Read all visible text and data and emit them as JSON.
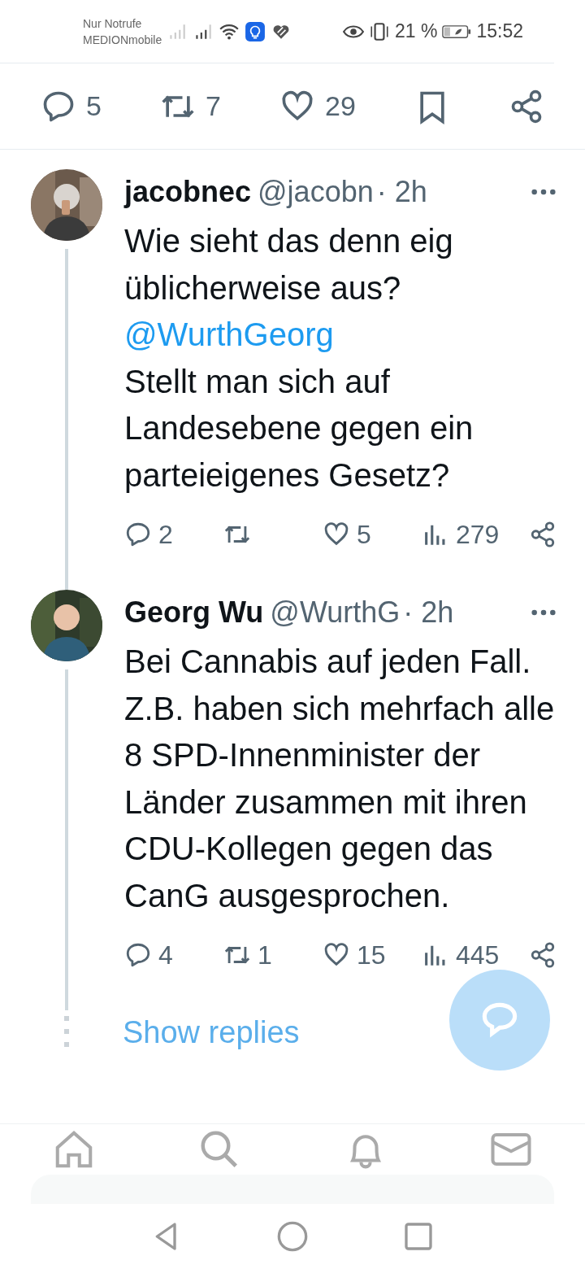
{
  "status_bar": {
    "carrier_lines": [
      "Nur Notrufe",
      "MEDIONmobile"
    ],
    "battery": "21 %",
    "time": "15:52"
  },
  "post_actions": [
    {
      "kind": "reply",
      "count": "5"
    },
    {
      "kind": "retweet",
      "count": "7"
    },
    {
      "kind": "like",
      "count": "29"
    },
    {
      "kind": "bookmark"
    },
    {
      "kind": "share"
    }
  ],
  "replies": [
    {
      "name": "jacobnec",
      "handle": "@jacobn",
      "time": "· 2h",
      "body": [
        {
          "kind": "text",
          "text": "Wie sieht das denn eig üblicherweise aus?"
        },
        {
          "kind": "mention",
          "text": "@WurthGeorg"
        },
        {
          "kind": "text",
          "text": "Stellt man sich auf Landesebene gegen ein parteieigenes Gesetz?"
        }
      ],
      "stats": [
        {
          "kind": "reply",
          "count": "2"
        },
        {
          "kind": "retweet"
        },
        {
          "kind": "like",
          "count": "5"
        },
        {
          "kind": "views",
          "count": "279"
        },
        {
          "kind": "share"
        }
      ]
    },
    {
      "name": "Georg Wu",
      "handle": "@WurthG",
      "time": "· 2h",
      "body": [
        {
          "kind": "text",
          "text": "Bei Cannabis auf jeden Fall. Z.B. haben sich mehrfach alle 8 SPD-Innenminister der Länder zusammen mit ihren CDU-Kollegen gegen das CanG ausgesprochen."
        }
      ],
      "stats": [
        {
          "kind": "reply",
          "count": "4"
        },
        {
          "kind": "retweet",
          "count": "1"
        },
        {
          "kind": "like",
          "count": "15"
        },
        {
          "kind": "views",
          "count": "445"
        },
        {
          "kind": "share"
        }
      ]
    }
  ],
  "show_replies": "Show replies",
  "bottom_nav": [
    {
      "kind": "home"
    },
    {
      "kind": "search"
    },
    {
      "kind": "notifications"
    },
    {
      "kind": "messages"
    }
  ]
}
